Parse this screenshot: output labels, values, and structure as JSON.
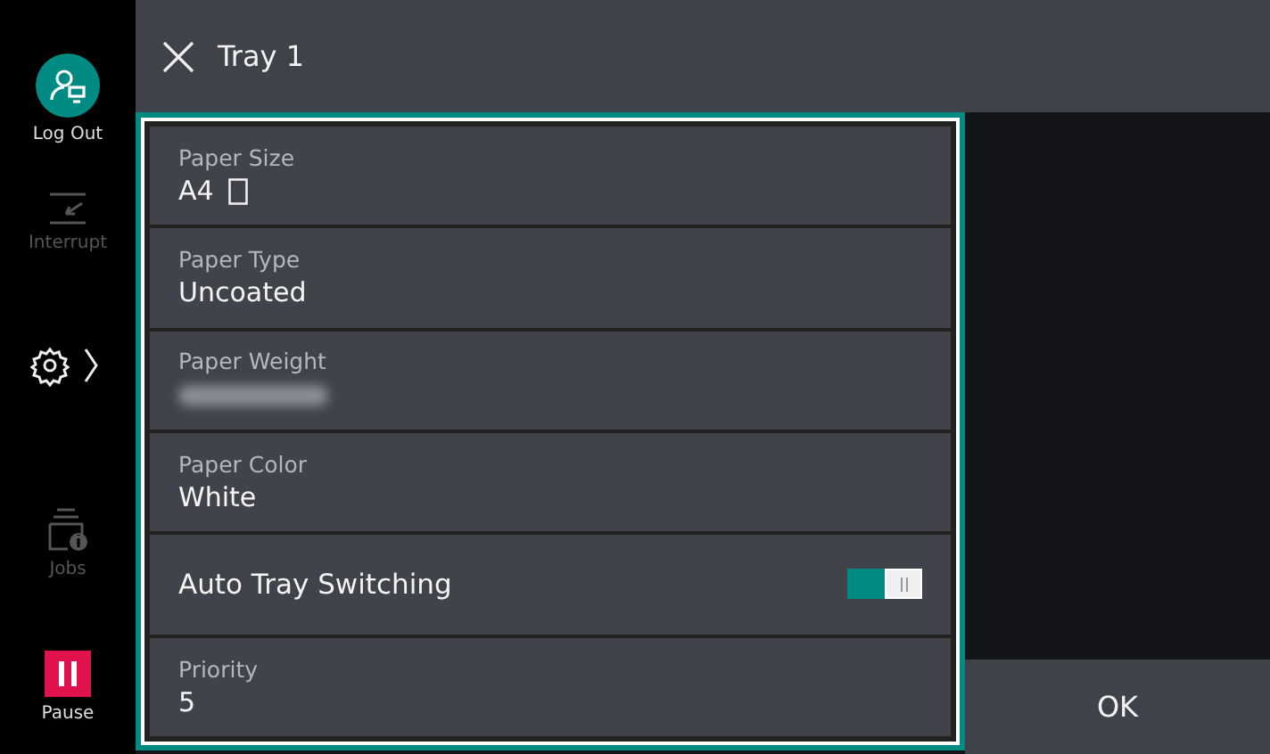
{
  "sidebar": {
    "items": [
      {
        "kind": "logout",
        "label": "Log Out",
        "disabled": false
      },
      {
        "kind": "interrupt",
        "label": "Interrupt",
        "disabled": true
      },
      {
        "kind": "settings"
      },
      {
        "kind": "jobs",
        "label": "Jobs",
        "disabled": true
      },
      {
        "kind": "pause",
        "label": "Pause",
        "disabled": false
      }
    ]
  },
  "header": {
    "title": "Tray 1"
  },
  "settings": [
    {
      "kind": "size_field",
      "label": "Paper Size",
      "value": "A4"
    },
    {
      "kind": "field",
      "label": "Paper Type",
      "value": "Uncoated"
    },
    {
      "kind": "field",
      "label": "Paper Weight",
      "value_hidden": true
    },
    {
      "kind": "field",
      "label": "Paper Color",
      "value": "White"
    },
    {
      "kind": "toggle",
      "label": "Auto Tray Switching",
      "on": true
    },
    {
      "kind": "field",
      "label": "Priority",
      "value": "5"
    }
  ],
  "buttons": [
    {
      "label": "OK"
    }
  ]
}
